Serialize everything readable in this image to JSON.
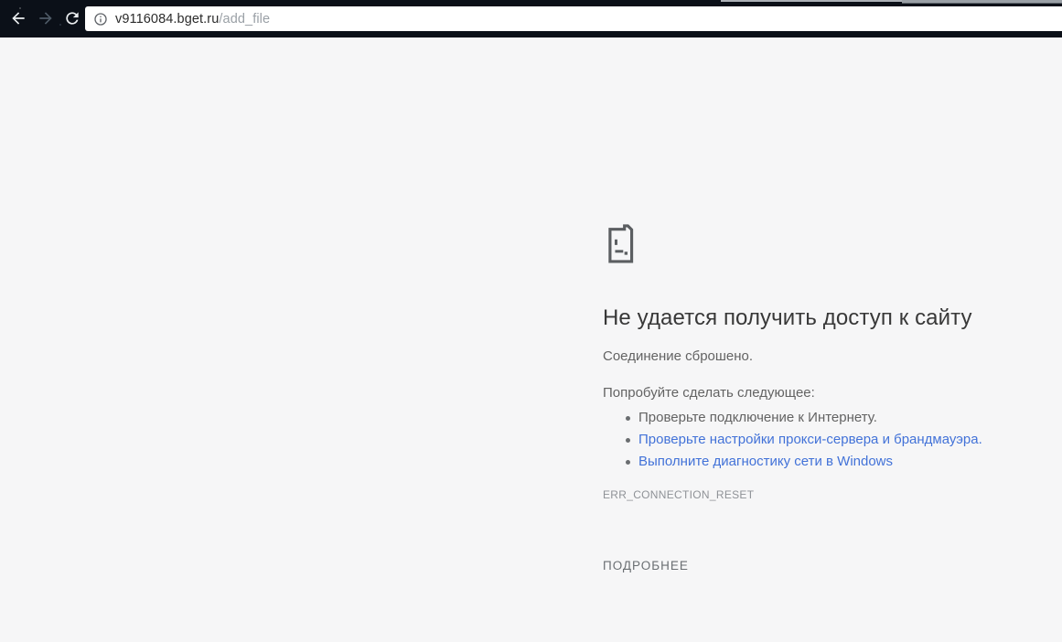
{
  "browser": {
    "address": {
      "host": "v9116084.bget.ru",
      "path": "/add_file"
    },
    "icons": {
      "back": "left-arrow",
      "forward": "right-arrow-disabled",
      "reload": "refresh-circle-arrow",
      "page_info": "info-circle-outline",
      "error_icon": "broken-page-sad-face"
    }
  },
  "error_page": {
    "title": "Не удается получить доступ к сайту",
    "subtitle": "Соединение сброшено.",
    "suggestions_header": "Попробуйте сделать следующее:",
    "suggestions": [
      {
        "text": "Проверьте подключение к Интернету.",
        "is_link": false
      },
      {
        "text": "Проверьте настройки прокси-сервера и брандмауэра.",
        "is_link": true
      },
      {
        "text": "Выполните диагностику сети в Windows",
        "is_link": true
      }
    ],
    "error_code": "ERR_CONNECTION_RESET",
    "details_button_label": "ПОДРОБНЕЕ"
  },
  "colors": {
    "toolbar_background": "#0b1018",
    "page_background": "#f6f6f7",
    "link": "#4272d8",
    "title_text": "#383838",
    "body_text": "#636363",
    "error_code_text": "#8f9297",
    "details_button_text": "#6b6f73",
    "url_host_text": "#2b2b2b",
    "url_path_text": "#9aa0a6"
  }
}
